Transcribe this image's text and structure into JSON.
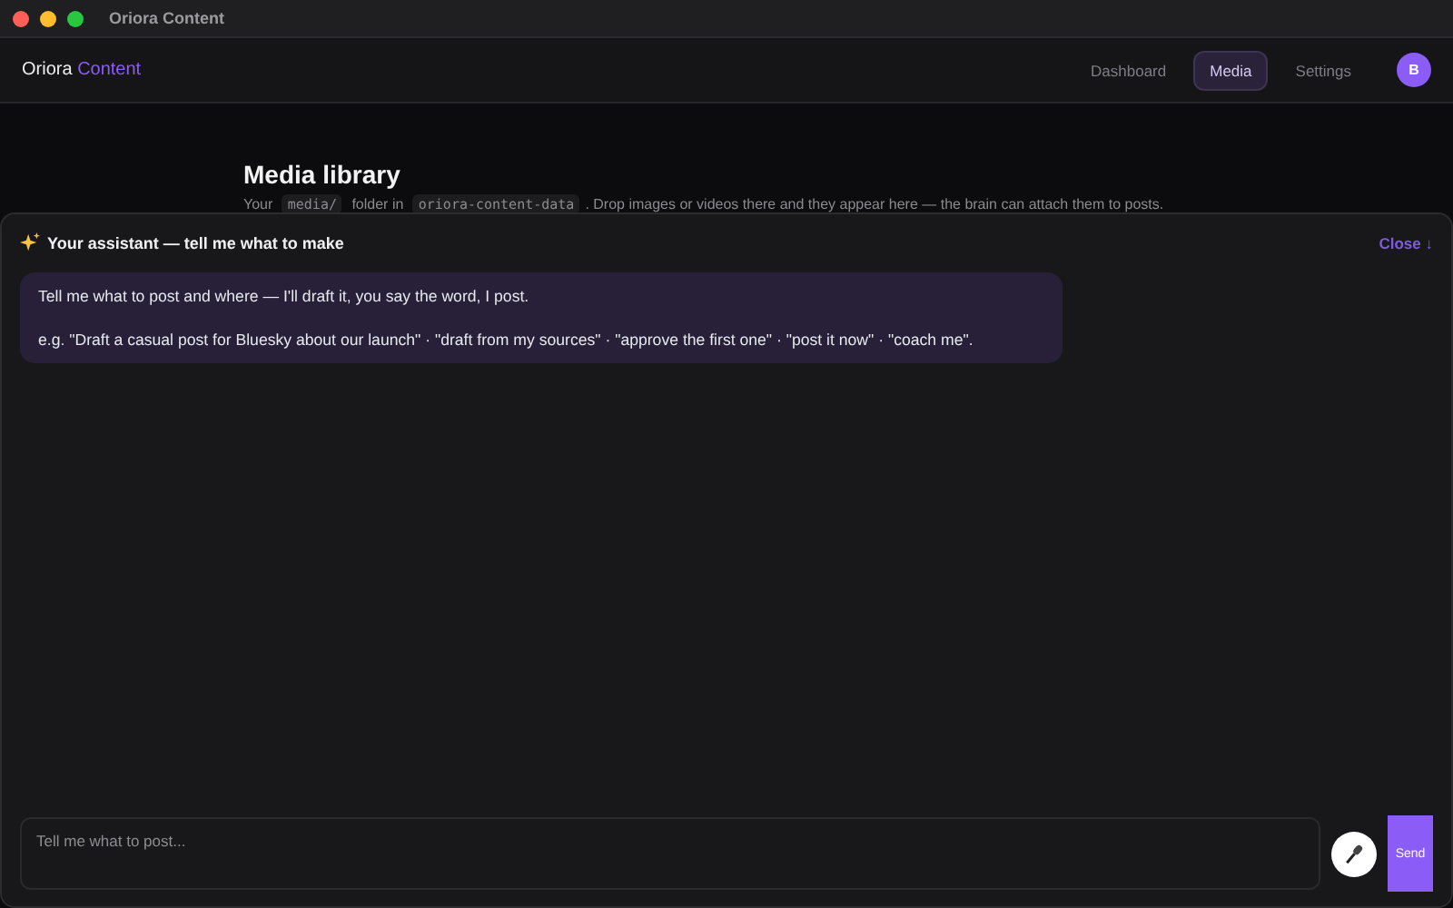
{
  "window": {
    "title": "Oriora Content"
  },
  "brand": {
    "name": "Oriora",
    "accent": "Content"
  },
  "nav": [
    {
      "label": "Dashboard",
      "selected": false
    },
    {
      "label": "Media",
      "selected": true
    },
    {
      "label": "Settings",
      "selected": false
    }
  ],
  "avatar": "B",
  "page": {
    "title": "Media library",
    "description": [
      {
        "kind": "text",
        "text": "Your"
      },
      {
        "kind": "code",
        "text": "media/"
      },
      {
        "kind": "text",
        "text": "folder in"
      },
      {
        "kind": "code",
        "text": "oriora-content-data"
      },
      {
        "kind": "text",
        "text": ". Drop images or videos there and they appear here — the brain can attach them to posts."
      }
    ]
  },
  "assistant": {
    "title": "Your assistant — tell me what to make",
    "close": "Close ↓",
    "messages": [
      {
        "lines": [
          "Tell me what to post and where — I'll draft it, you say the word, I post.",
          "e.g. \"Draft a casual post for Bluesky about our launch\" · \"draft from my sources\" · \"approve the first one\" · \"post it now\" · \"coach me\"."
        ]
      }
    ],
    "input": {
      "placeholder": "Tell me what to post..."
    },
    "send": "Send"
  }
}
